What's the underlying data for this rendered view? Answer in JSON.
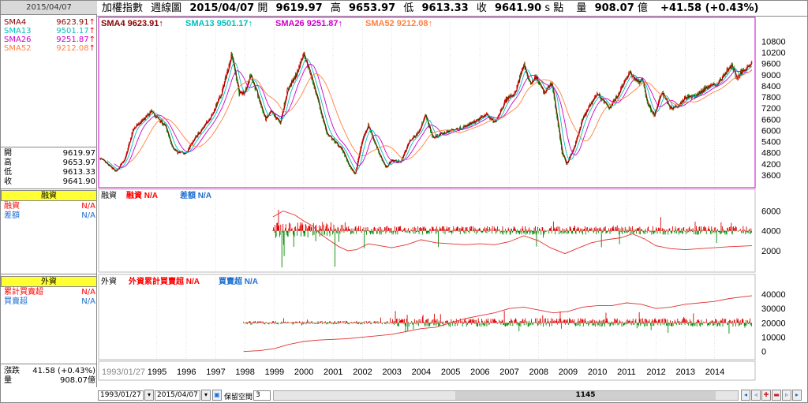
{
  "left": {
    "date": "2015/04/07",
    "sma": [
      {
        "label": "SMA4",
        "value": "9623.91",
        "color": "#8b0000"
      },
      {
        "label": "SMA13",
        "value": "9501.17",
        "color": "#00bfbf"
      },
      {
        "label": "SMA26",
        "value": "9251.87",
        "color": "#cc00cc"
      },
      {
        "label": "SMA52",
        "value": "9212.08",
        "color": "#ff8040"
      }
    ],
    "ohlc": [
      {
        "label": "開",
        "value": "9619.97"
      },
      {
        "label": "高",
        "value": "9653.97"
      },
      {
        "label": "低",
        "value": "9613.33"
      },
      {
        "label": "收",
        "value": "9641.90"
      }
    ],
    "margin_title": "融資",
    "margin_rows": [
      {
        "label": "融資",
        "value": "N/A",
        "color": "#ff0000"
      },
      {
        "label": "差額",
        "value": "N/A",
        "color": "#1e6fd0"
      }
    ],
    "foreign_title": "外資",
    "foreign_rows": [
      {
        "label": "累計買賣超",
        "value": "N/A",
        "color": "#ff0000"
      },
      {
        "label": "買賣超",
        "value": "N/A",
        "color": "#1e6fd0"
      }
    ],
    "change_label": "漲跌",
    "change_value": "41.58 (+0.43%)",
    "volume_label": "量",
    "volume_value": "908.07億"
  },
  "topbar": {
    "name": "加權指數",
    "period": "週線圖",
    "date": "2015/04/07",
    "open_label": "開",
    "open": "9619.97",
    "high_label": "高",
    "high": "9653.97",
    "low_label": "低",
    "low": "9613.33",
    "close_label": "收",
    "close": "9641.90",
    "unit": "s 點",
    "vol_label": "量",
    "vol": "908.07",
    "vol_unit": "億",
    "change": "+41.58 (+0.43%)"
  },
  "main_legend": [
    {
      "text": "SMA4 9623.91↑",
      "color": "#8b0000"
    },
    {
      "text": "SMA13 9501.17↑",
      "color": "#00bfbf"
    },
    {
      "text": "SMA26 9251.87↑",
      "color": "#cc00cc"
    },
    {
      "text": "SMA52 9212.08↑",
      "color": "#ff8040"
    }
  ],
  "margin_legend": [
    {
      "text": "融資",
      "color": "#000"
    },
    {
      "text": "融資 N/A",
      "color": "#ff0000"
    },
    {
      "text": "差額 N/A",
      "color": "#1e6fd0"
    }
  ],
  "foreign_legend": [
    {
      "text": "外資",
      "color": "#000"
    },
    {
      "text": "外資累計買賣超 N/A",
      "color": "#ff0000"
    },
    {
      "text": "買賣超 N/A",
      "color": "#1e6fd0"
    }
  ],
  "bottom": {
    "start_date": "1993/01/27",
    "end_date": "2015/04/07",
    "mode_label": "保留空間",
    "mode_value": "3",
    "thumb_value": "1145"
  },
  "chart_data": [
    {
      "type": "candlestick",
      "title": "加權指數 週線圖",
      "x_labels": [
        "1993/01/27",
        "1995",
        "1996",
        "1997",
        "1998",
        "1999",
        "2000",
        "2001",
        "2002",
        "2003",
        "2004",
        "2005",
        "2006",
        "2007",
        "2008",
        "2009",
        "2010",
        "2011",
        "2012",
        "2013",
        "2014"
      ],
      "x_range": [
        1993.07,
        2015.27
      ],
      "ylim": [
        3000,
        11200
      ],
      "y_ticks": [
        3600,
        4200,
        4800,
        5400,
        6000,
        6600,
        7200,
        7800,
        8400,
        9000,
        9600,
        10200,
        10800
      ],
      "price_keypoints": [
        [
          1993.07,
          4500
        ],
        [
          1993.3,
          4200
        ],
        [
          1993.6,
          3800
        ],
        [
          1993.9,
          4400
        ],
        [
          1994.2,
          6100
        ],
        [
          1994.5,
          6500
        ],
        [
          1994.8,
          7000
        ],
        [
          1995.0,
          6700
        ],
        [
          1995.3,
          6200
        ],
        [
          1995.5,
          5200
        ],
        [
          1995.7,
          4800
        ],
        [
          1996.0,
          4800
        ],
        [
          1996.3,
          5600
        ],
        [
          1996.6,
          6200
        ],
        [
          1996.9,
          6900
        ],
        [
          1997.2,
          8000
        ],
        [
          1997.55,
          10100
        ],
        [
          1997.8,
          8000
        ],
        [
          1998.0,
          8100
        ],
        [
          1998.2,
          9000
        ],
        [
          1998.45,
          7800
        ],
        [
          1998.7,
          6600
        ],
        [
          1998.9,
          7000
        ],
        [
          1999.2,
          6400
        ],
        [
          1999.45,
          8200
        ],
        [
          1999.75,
          9000
        ],
        [
          2000.0,
          10200
        ],
        [
          2000.3,
          8700
        ],
        [
          2000.55,
          7200
        ],
        [
          2000.8,
          5800
        ],
        [
          2001.0,
          5500
        ],
        [
          2001.3,
          5000
        ],
        [
          2001.55,
          4100
        ],
        [
          2001.75,
          3650
        ],
        [
          2002.0,
          5500
        ],
        [
          2002.2,
          6300
        ],
        [
          2002.5,
          5000
        ],
        [
          2002.8,
          4000
        ],
        [
          2003.0,
          4400
        ],
        [
          2003.3,
          4300
        ],
        [
          2003.6,
          5400
        ],
        [
          2003.9,
          5900
        ],
        [
          2004.15,
          6800
        ],
        [
          2004.4,
          5600
        ],
        [
          2004.7,
          5800
        ],
        [
          2005.0,
          6000
        ],
        [
          2005.5,
          6200
        ],
        [
          2005.9,
          6500
        ],
        [
          2006.2,
          6900
        ],
        [
          2006.5,
          6400
        ],
        [
          2006.9,
          7700
        ],
        [
          2007.2,
          8000
        ],
        [
          2007.5,
          9600
        ],
        [
          2007.7,
          8500
        ],
        [
          2007.9,
          8900
        ],
        [
          2008.2,
          8000
        ],
        [
          2008.45,
          8600
        ],
        [
          2008.6,
          7000
        ],
        [
          2008.8,
          4800
        ],
        [
          2008.95,
          4200
        ],
        [
          2009.2,
          5000
        ],
        [
          2009.5,
          6600
        ],
        [
          2009.8,
          7500
        ],
        [
          2010.0,
          8000
        ],
        [
          2010.4,
          7200
        ],
        [
          2010.7,
          7900
        ],
        [
          2010.9,
          8600
        ],
        [
          2011.1,
          9100
        ],
        [
          2011.4,
          8600
        ],
        [
          2011.55,
          8700
        ],
        [
          2011.7,
          7500
        ],
        [
          2011.95,
          6800
        ],
        [
          2012.2,
          8100
        ],
        [
          2012.5,
          7200
        ],
        [
          2012.8,
          7400
        ],
        [
          2013.0,
          7800
        ],
        [
          2013.3,
          7800
        ],
        [
          2013.55,
          8100
        ],
        [
          2013.8,
          8400
        ],
        [
          2014.1,
          8500
        ],
        [
          2014.4,
          9200
        ],
        [
          2014.6,
          9500
        ],
        [
          2014.75,
          8800
        ],
        [
          2015.0,
          9300
        ],
        [
          2015.27,
          9640
        ]
      ]
    },
    {
      "type": "bar+line",
      "title": "融資",
      "x_range": [
        1993.07,
        2015.27
      ],
      "ylim": [
        0,
        7000
      ],
      "y_ticks": [
        2000,
        4000,
        6000
      ],
      "bar_baseline": 4000,
      "bar_start": 1998.95,
      "line_keypoints": [
        [
          1998.95,
          5400
        ],
        [
          1999.3,
          6000
        ],
        [
          1999.7,
          5600
        ],
        [
          2000.0,
          5000
        ],
        [
          2000.3,
          4500
        ],
        [
          2000.6,
          3600
        ],
        [
          2000.9,
          3000
        ],
        [
          2001.2,
          2400
        ],
        [
          2001.5,
          2000
        ],
        [
          2001.8,
          2100
        ],
        [
          2002.2,
          2700
        ],
        [
          2002.6,
          2500
        ],
        [
          2003.0,
          2300
        ],
        [
          2003.5,
          2600
        ],
        [
          2004.0,
          3100
        ],
        [
          2004.5,
          2800
        ],
        [
          2005.0,
          2700
        ],
        [
          2005.5,
          2600
        ],
        [
          2006.0,
          2700
        ],
        [
          2006.5,
          2600
        ],
        [
          2007.0,
          2900
        ],
        [
          2007.5,
          3500
        ],
        [
          2008.0,
          3000
        ],
        [
          2008.4,
          2300
        ],
        [
          2008.9,
          1700
        ],
        [
          2009.3,
          2200
        ],
        [
          2009.8,
          2800
        ],
        [
          2010.3,
          3100
        ],
        [
          2010.8,
          3300
        ],
        [
          2011.2,
          3700
        ],
        [
          2011.6,
          3200
        ],
        [
          2012.0,
          2500
        ],
        [
          2012.5,
          2200
        ],
        [
          2013.0,
          2100
        ],
        [
          2013.5,
          2200
        ],
        [
          2014.0,
          2300
        ],
        [
          2014.5,
          2400
        ],
        [
          2015.27,
          2500
        ]
      ]
    },
    {
      "type": "bar+line",
      "title": "外資",
      "x_range": [
        1993.07,
        2015.27
      ],
      "ylim": [
        -4000,
        45000
      ],
      "y_ticks": [
        0,
        10000,
        20000,
        30000,
        40000
      ],
      "bar_baseline": 20000,
      "bar_start": 1997.95,
      "line_keypoints": [
        [
          1997.95,
          0
        ],
        [
          1998.5,
          600
        ],
        [
          1999.0,
          2000
        ],
        [
          1999.5,
          5000
        ],
        [
          2000.0,
          7000
        ],
        [
          2000.5,
          8000
        ],
        [
          2001.0,
          8500
        ],
        [
          2001.5,
          9000
        ],
        [
          2002.0,
          10000
        ],
        [
          2002.5,
          11000
        ],
        [
          2003.0,
          12000
        ],
        [
          2003.5,
          14000
        ],
        [
          2004.0,
          16000
        ],
        [
          2004.5,
          17000
        ],
        [
          2005.0,
          20000
        ],
        [
          2005.5,
          23000
        ],
        [
          2006.0,
          25000
        ],
        [
          2006.5,
          27000
        ],
        [
          2007.0,
          30000
        ],
        [
          2007.5,
          31000
        ],
        [
          2008.0,
          29000
        ],
        [
          2008.5,
          27000
        ],
        [
          2009.0,
          28000
        ],
        [
          2009.5,
          31000
        ],
        [
          2010.0,
          32000
        ],
        [
          2010.5,
          32000
        ],
        [
          2011.0,
          34000
        ],
        [
          2011.5,
          33000
        ],
        [
          2012.0,
          30000
        ],
        [
          2012.5,
          31000
        ],
        [
          2013.0,
          33000
        ],
        [
          2013.5,
          34000
        ],
        [
          2014.0,
          35000
        ],
        [
          2014.5,
          37000
        ],
        [
          2015.27,
          39000
        ]
      ]
    }
  ]
}
